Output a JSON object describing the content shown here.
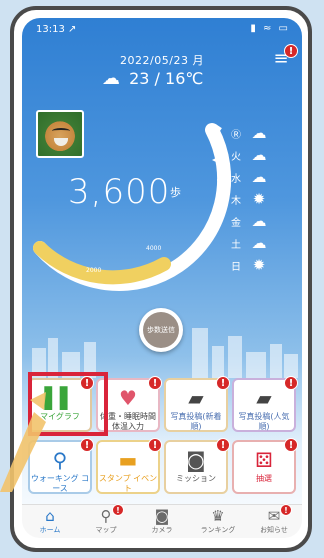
{
  "status_bar": {
    "time": "13:13 ↗",
    "icons": "▮ ≈ ▭"
  },
  "header": {
    "date": "2022/05/23 月",
    "weather_icon": "cloud-rain-icon",
    "weather": "23 / 16℃",
    "menu_badge": "!"
  },
  "steps": {
    "count": "3,600",
    "unit": "歩",
    "gauge_labels": [
      "2000",
      "4000",
      "8000"
    ]
  },
  "forecast": [
    {
      "day": "Ⓡ",
      "icon": "cloud-icon",
      "glyph": "☁"
    },
    {
      "day": "火",
      "icon": "cloud-icon",
      "glyph": "☁"
    },
    {
      "day": "水",
      "icon": "cloud-icon",
      "glyph": "☁"
    },
    {
      "day": "木",
      "icon": "sun-icon",
      "glyph": "✹"
    },
    {
      "day": "金",
      "icon": "cloud-rain-icon",
      "glyph": "☁"
    },
    {
      "day": "土",
      "icon": "cloud-rain-icon",
      "glyph": "☁"
    },
    {
      "day": "日",
      "icon": "sun-icon",
      "glyph": "✹"
    }
  ],
  "send_button": {
    "label": "歩数送信"
  },
  "tiles": [
    {
      "label": "マイグラフ",
      "glyph": "▌▌",
      "icon": "bar-chart-icon",
      "color": "#3aa53a"
    },
    {
      "label": "体重・睡眠時間 体温入力",
      "glyph": "♥",
      "icon": "heart-icon",
      "color": "#e0556b"
    },
    {
      "label": "写真投稿(新着順)",
      "glyph": "▰",
      "icon": "photo-icon",
      "color": "#444444"
    },
    {
      "label": "写真投稿(人気順)",
      "glyph": "▰",
      "icon": "photo-icon",
      "color": "#444444"
    },
    {
      "label": "ウォーキング コース",
      "glyph": "⚲",
      "icon": "route-icon",
      "color": "#2a78c8"
    },
    {
      "label": "スタンプ イベント",
      "glyph": "▬",
      "icon": "stamp-icon",
      "color": "#e8a020"
    },
    {
      "label": "ミッション",
      "glyph": "◙",
      "icon": "mission-icon",
      "color": "#555555"
    },
    {
      "label": "抽選",
      "glyph": "⚄",
      "icon": "gift-icon",
      "color": "#d9243a"
    }
  ],
  "tabs": [
    {
      "label": "ホーム",
      "glyph": "⌂",
      "icon": "home-icon",
      "active": true
    },
    {
      "label": "マップ",
      "glyph": "⚲",
      "icon": "map-pin-icon",
      "active": false
    },
    {
      "label": "カメラ",
      "glyph": "◙",
      "icon": "camera-icon",
      "active": false
    },
    {
      "label": "ランキング",
      "glyph": "♛",
      "icon": "crown-icon",
      "active": false
    },
    {
      "label": "お知らせ",
      "glyph": "✉",
      "icon": "chat-icon",
      "active": false
    }
  ],
  "badge": "!"
}
